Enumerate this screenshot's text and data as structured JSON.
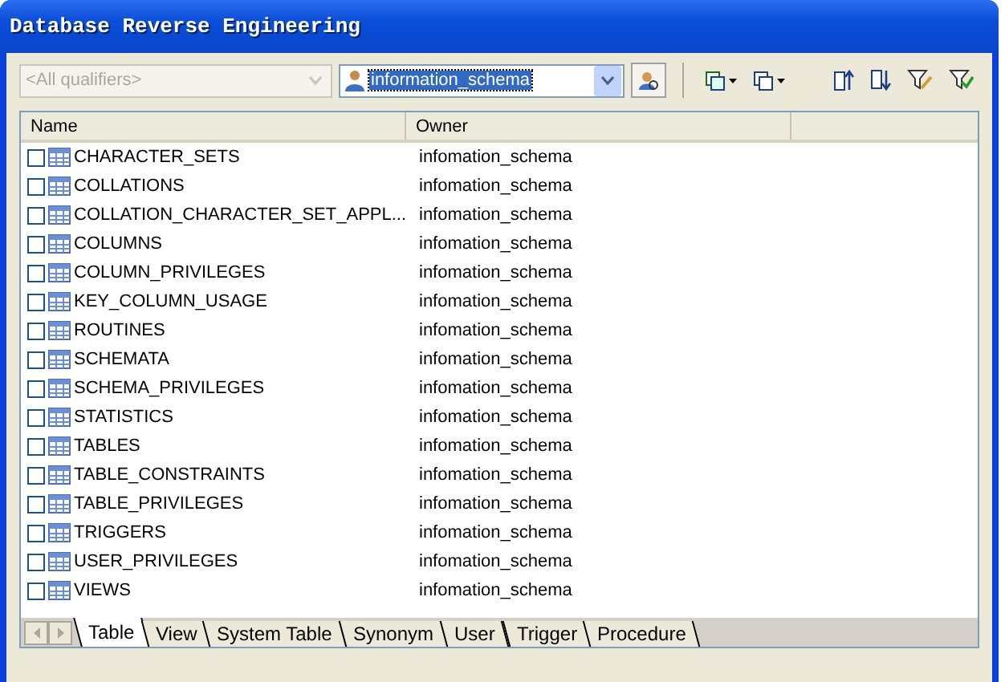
{
  "window": {
    "title": "Database Reverse Engineering"
  },
  "toolbar": {
    "qualifier": {
      "placeholder": "<All qualifiers>",
      "disabled": true
    },
    "owner": {
      "value": "information_schema"
    }
  },
  "table": {
    "columns": [
      "Name",
      "Owner"
    ],
    "rows": [
      {
        "name": "CHARACTER_SETS",
        "owner": "infomation_schema",
        "checked": false
      },
      {
        "name": "COLLATIONS",
        "owner": "infomation_schema",
        "checked": false
      },
      {
        "name": "COLLATION_CHARACTER_SET_APPL...",
        "owner": "infomation_schema",
        "checked": false
      },
      {
        "name": "COLUMNS",
        "owner": "infomation_schema",
        "checked": false
      },
      {
        "name": "COLUMN_PRIVILEGES",
        "owner": "infomation_schema",
        "checked": false
      },
      {
        "name": "KEY_COLUMN_USAGE",
        "owner": "infomation_schema",
        "checked": false
      },
      {
        "name": "ROUTINES",
        "owner": "infomation_schema",
        "checked": false
      },
      {
        "name": "SCHEMATA",
        "owner": "infomation_schema",
        "checked": false
      },
      {
        "name": "SCHEMA_PRIVILEGES",
        "owner": "infomation_schema",
        "checked": false
      },
      {
        "name": "STATISTICS",
        "owner": "infomation_schema",
        "checked": false
      },
      {
        "name": "TABLES",
        "owner": "infomation_schema",
        "checked": false
      },
      {
        "name": "TABLE_CONSTRAINTS",
        "owner": "infomation_schema",
        "checked": false
      },
      {
        "name": "TABLE_PRIVILEGES",
        "owner": "infomation_schema",
        "checked": false
      },
      {
        "name": "TRIGGERS",
        "owner": "infomation_schema",
        "checked": false
      },
      {
        "name": "USER_PRIVILEGES",
        "owner": "infomation_schema",
        "checked": false
      },
      {
        "name": "VIEWS",
        "owner": "infomation_schema",
        "checked": false
      }
    ]
  },
  "tabs": [
    {
      "label": "Table",
      "selected": true
    },
    {
      "label": "View",
      "selected": false
    },
    {
      "label": "System Table",
      "selected": false
    },
    {
      "label": "Synonym",
      "selected": false
    },
    {
      "label": "User",
      "selected": false
    },
    {
      "label": "Trigger",
      "selected": false
    },
    {
      "label": "Procedure",
      "selected": false
    }
  ]
}
